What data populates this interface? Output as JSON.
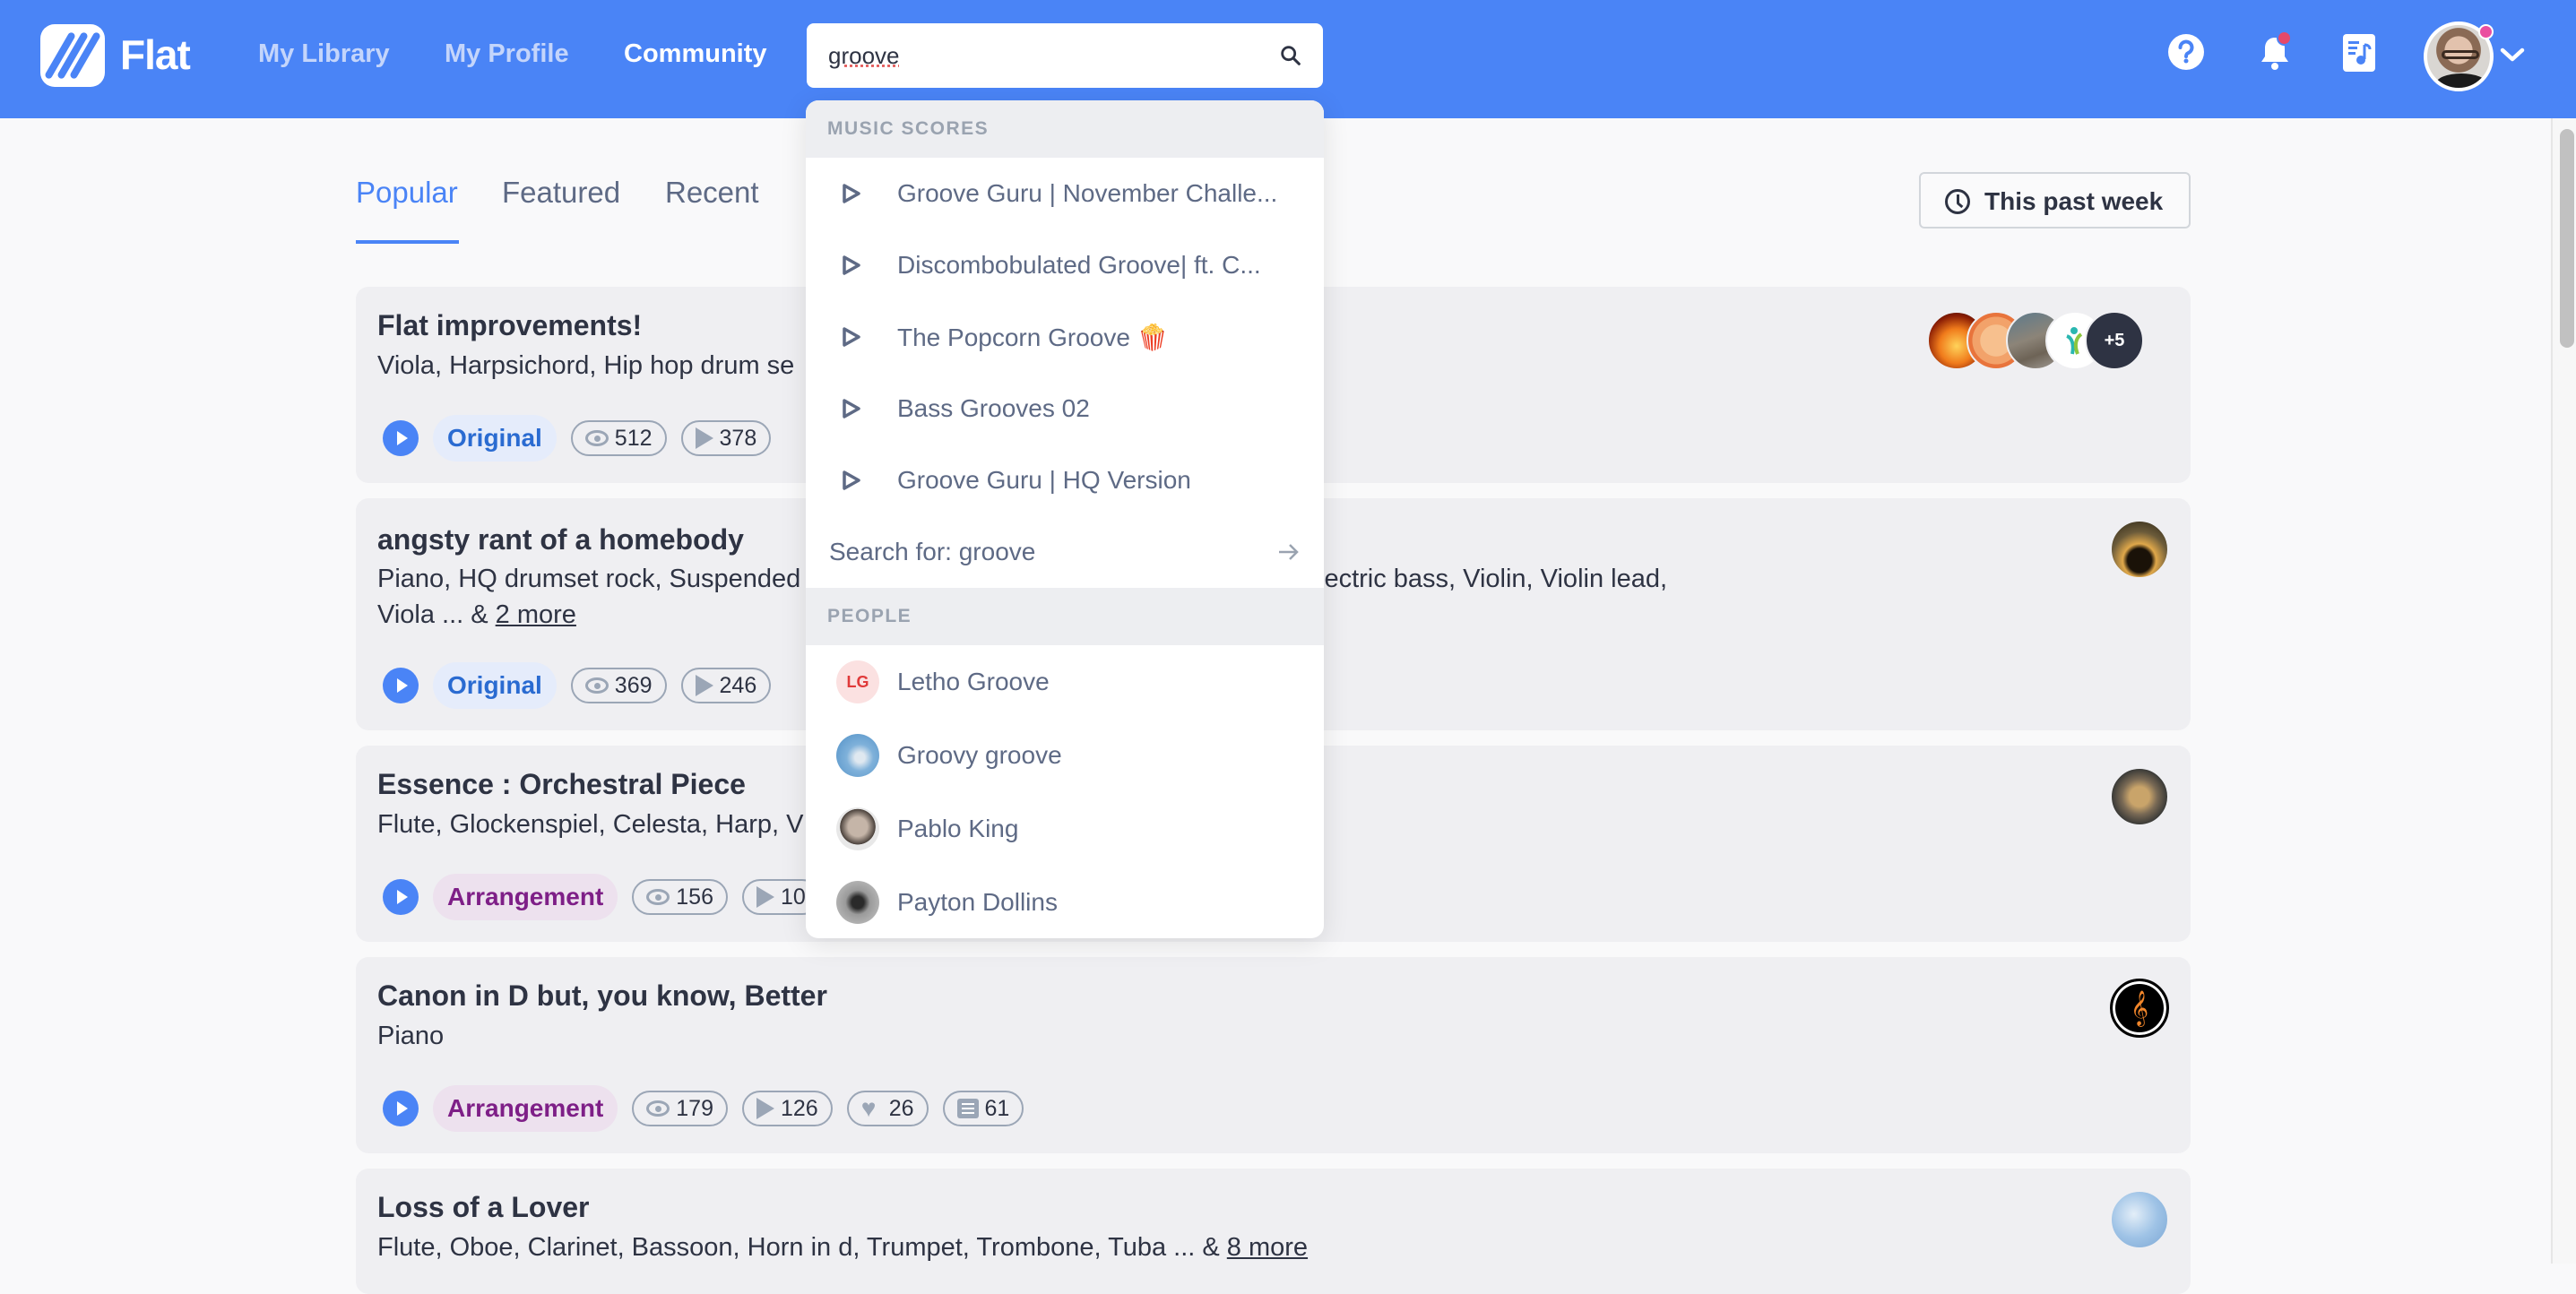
{
  "header": {
    "brand": "Flat",
    "nav": [
      {
        "label": "My Library",
        "active": false
      },
      {
        "label": "My Profile",
        "active": false
      },
      {
        "label": "Community",
        "active": true
      }
    ],
    "search": {
      "value": "groove",
      "placeholder": "Search"
    },
    "icons": [
      "help-icon",
      "notifications-icon",
      "new-score-icon",
      "profile-avatar",
      "chevron-down-icon"
    ],
    "brand_color": "#4a84f6"
  },
  "tabs": [
    {
      "label": "Popular",
      "active": true
    },
    {
      "label": "Featured",
      "active": false
    },
    {
      "label": "Recent",
      "active": false
    }
  ],
  "period_filter": {
    "label": "This past week"
  },
  "scores": [
    {
      "title": "Flat improvements!",
      "instruments": "Viola, Harpsichord, Hip hop drum se",
      "more": "",
      "type": "Original",
      "views": "512",
      "plays": "378",
      "extra_avatars": "+5"
    },
    {
      "title": "angsty rant of a homebody",
      "instruments": "Piano, HQ drumset rock, Suspended",
      "instruments_tail": "lectric bass, Violin, Violin lead,",
      "instruments_line2": "Viola ... & ",
      "more": "2 more",
      "type": "Original",
      "views": "369",
      "plays": "246"
    },
    {
      "title": "Essence : Orchestral Piece",
      "instruments": "Flute, Glockenspiel, Celesta, Harp, V",
      "type": "Arrangement",
      "views": "156",
      "plays": "10"
    },
    {
      "title": "Canon in D but, you know, Better",
      "instruments": "Piano",
      "type": "Arrangement",
      "views": "179",
      "plays": "126",
      "likes": "26",
      "comments": "61"
    },
    {
      "title": "Loss of a Lover",
      "instruments": "Flute, Oboe, Clarinet, Bassoon, Horn in d, Trumpet, Trombone, Tuba ... & ",
      "more": "8 more"
    }
  ],
  "dropdown": {
    "scores_header": "MUSIC SCORES",
    "scores": [
      "Groove Guru | November Challe...",
      "Discombobulated Groove| ft. C...",
      "The Popcorn Groove 🍿",
      "Bass Grooves 02",
      "Groove Guru | HQ Version"
    ],
    "search_for": "Search for: groove",
    "people_header": "PEOPLE",
    "people": [
      {
        "name": "Letho Groove",
        "initials": "LG"
      },
      {
        "name": "Groovy groove",
        "initials": ""
      },
      {
        "name": "Pablo King",
        "initials": ""
      },
      {
        "name": "Payton Dollins",
        "initials": ""
      }
    ]
  }
}
